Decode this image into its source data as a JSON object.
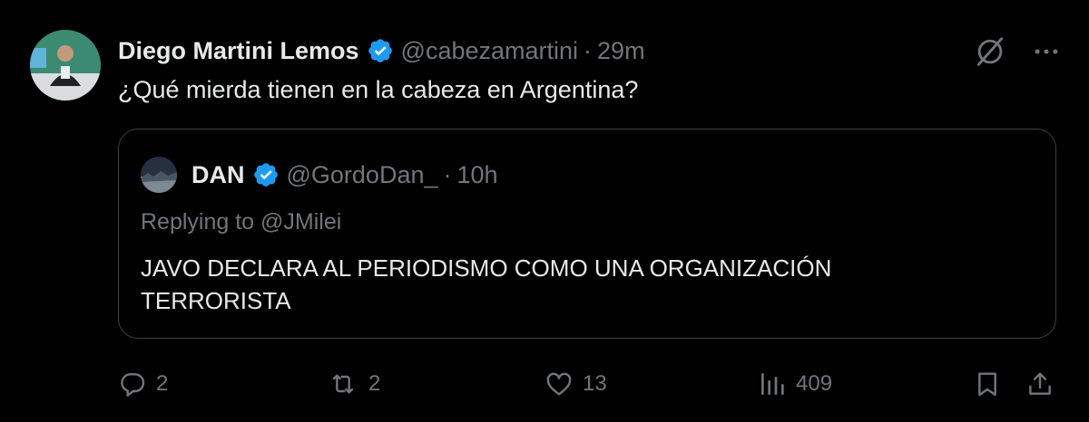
{
  "tweet": {
    "author_name": "Diego Martini Lemos",
    "handle": "@cabezamartini",
    "separator": "·",
    "time": "29m",
    "text": "¿Qué mierda tienen en la cabeza en Argentina?"
  },
  "quoted": {
    "author_name": "DAN",
    "handle": "@GordoDan_",
    "separator": "·",
    "time": "10h",
    "replying_prefix": "Replying to",
    "replying_to": "@JMilei",
    "text_line1": "JAVO DECLARA AL PERIODISMO COMO UNA ORGANIZACIÓN",
    "text_line2": "TERRORISTA"
  },
  "actions": {
    "replies": "2",
    "reposts": "2",
    "likes": "13",
    "views": "409"
  },
  "icons": {
    "verified": "verified-badge-icon",
    "grok": "grok-icon",
    "more": "more-icon",
    "reply": "reply-icon",
    "repost": "repost-icon",
    "like": "heart-icon",
    "views": "views-icon",
    "bookmark": "bookmark-icon",
    "share": "share-icon"
  },
  "colors": {
    "background": "#000000",
    "text": "#e7e9ea",
    "muted": "#71767b",
    "verified": "#1d9bf0",
    "border": "#3e4144"
  }
}
